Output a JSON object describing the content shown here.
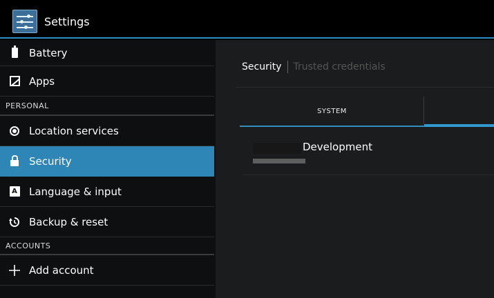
{
  "actionbar": {
    "title": "Settings",
    "icon": "settings-sliders-icon"
  },
  "sidebar": {
    "items": [
      {
        "type": "item",
        "label": "Battery",
        "icon": "battery-icon"
      },
      {
        "type": "item",
        "label": "Apps",
        "icon": "apps-icon"
      },
      {
        "type": "header",
        "label": "PERSONAL"
      },
      {
        "type": "item",
        "label": "Location services",
        "icon": "location-icon"
      },
      {
        "type": "item",
        "label": "Security",
        "icon": "lock-icon",
        "selected": true
      },
      {
        "type": "item",
        "label": "Language & input",
        "icon": "keyboard-icon"
      },
      {
        "type": "item",
        "label": "Backup & reset",
        "icon": "restore-icon"
      },
      {
        "type": "header",
        "label": "ACCOUNTS"
      },
      {
        "type": "item",
        "label": "Add account",
        "icon": "plus-icon"
      }
    ]
  },
  "content": {
    "breadcrumb": {
      "parent": "Security",
      "current": "Trusted credentials"
    },
    "tabs": {
      "system": "SYSTEM",
      "user": ""
    },
    "certificates": [
      {
        "title": "Development"
      }
    ]
  },
  "colors": {
    "accent": "#2e86b6",
    "background": "#000000",
    "content_background": "#1b1c1d"
  }
}
